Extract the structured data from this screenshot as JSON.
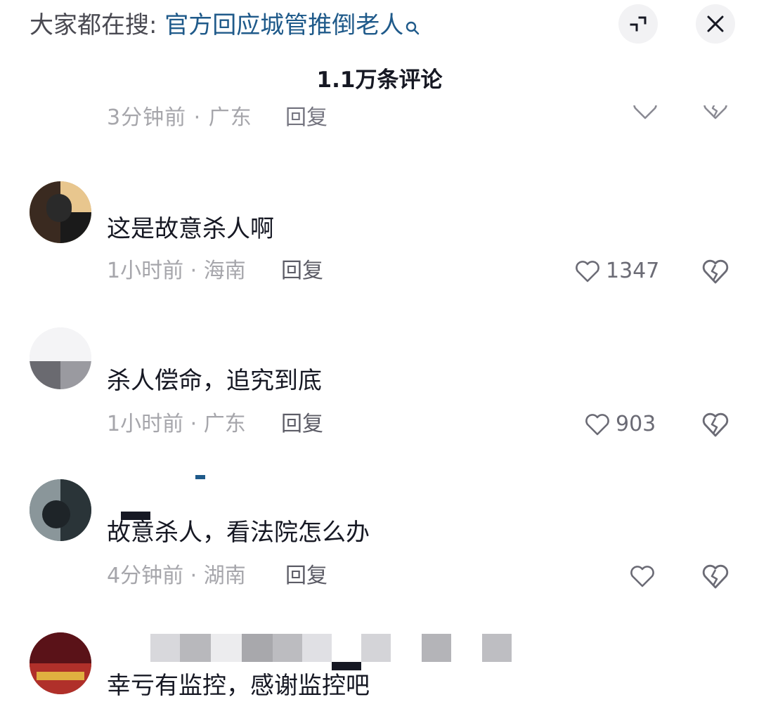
{
  "header": {
    "search_prefix": "大家都在搜: ",
    "search_keyword": "官方回应城管推倒老人",
    "comment_count_label": "1.1万条评论"
  },
  "partial_comment": {
    "meta": "3分钟前 · 广东",
    "reply_label": "回复"
  },
  "comments": [
    {
      "text": "这是故意杀人啊",
      "time": "1小时前",
      "location": "海南",
      "reply_label": "回复",
      "likes": "1347"
    },
    {
      "text": "杀人偿命，追究到底",
      "time": "1小时前",
      "location": "广东",
      "reply_label": "回复",
      "likes": "903"
    },
    {
      "text": "故意杀人，看法院怎么办",
      "time": "4分钟前",
      "location": "湖南",
      "reply_label": "回复",
      "likes": ""
    },
    {
      "text": "幸亏有监控，感谢监控吧"
    }
  ],
  "meta_separator": " · ",
  "colors": {
    "keyword_blue": "#1f5a8a",
    "meta_gray": "#a6a6ab",
    "text_dark": "#161823"
  },
  "icons": {
    "search": "search-icon",
    "expand": "collapse-arrows-icon",
    "close": "close-icon",
    "like": "heart-outline-icon",
    "dislike": "broken-heart-icon"
  }
}
